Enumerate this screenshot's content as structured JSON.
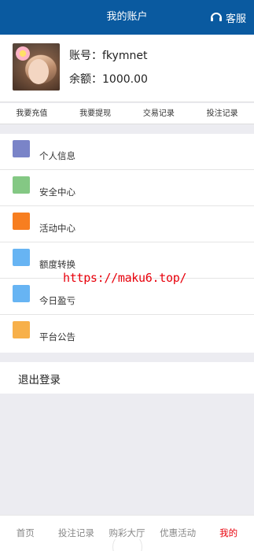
{
  "header": {
    "title": "我的账户",
    "service_label": "客服"
  },
  "profile": {
    "account_label": "账号：",
    "account": "fkymnet",
    "balance_label": "余额：",
    "balance": "1000.00"
  },
  "quick_actions": [
    "我要充值",
    "我要提现",
    "交易记录",
    "投注记录"
  ],
  "menu": [
    {
      "label": "个人信息",
      "color": "#7a84c8"
    },
    {
      "label": "安全中心",
      "color": "#84c884"
    },
    {
      "label": "活动中心",
      "color": "#f77e20"
    },
    {
      "label": "额度转换",
      "color": "#67b4f3"
    },
    {
      "label": "今日盈亏",
      "color": "#67b4f3"
    },
    {
      "label": "平台公告",
      "color": "#f7b04a"
    }
  ],
  "logout_label": "退出登录",
  "watermark": "https://maku6.top/",
  "tabbar": [
    {
      "label": "首页"
    },
    {
      "label": "投注记录"
    },
    {
      "label": "购彩大厅"
    },
    {
      "label": "优惠活动"
    },
    {
      "label": "我的",
      "active": true
    }
  ],
  "colors": {
    "header_bg": "#0a5aa0",
    "accent_red": "#e8000b",
    "page_bg": "#ececf1"
  }
}
